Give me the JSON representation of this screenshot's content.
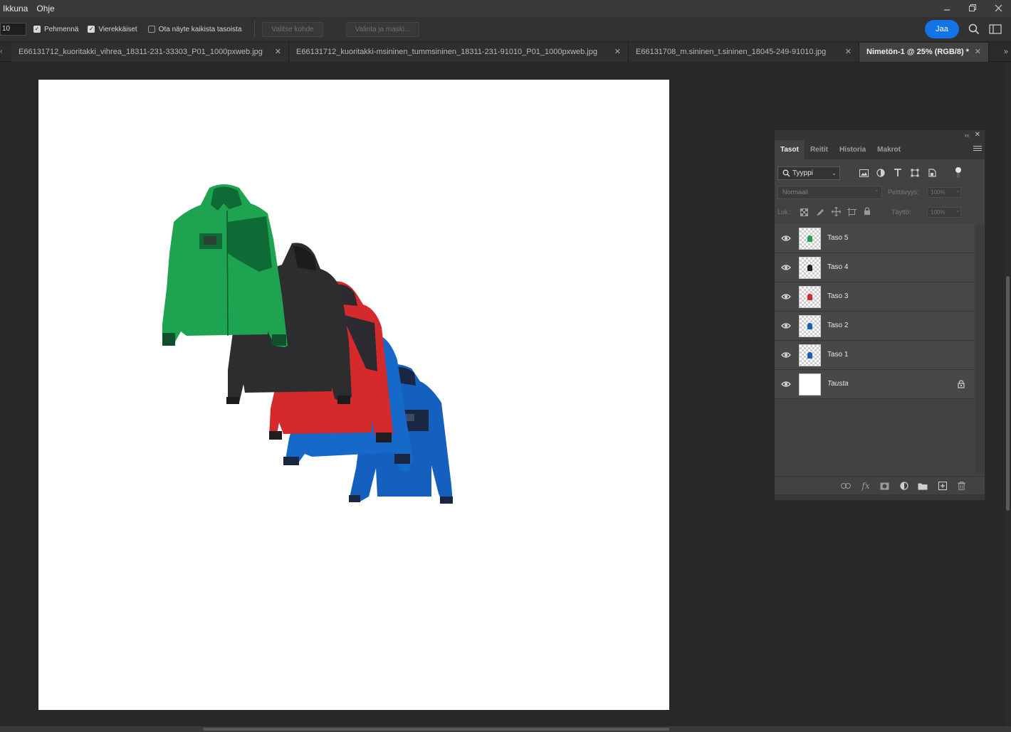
{
  "menubar": {
    "items": [
      "Ikkuna",
      "Ohje"
    ],
    "window_controls": [
      "minimize-icon",
      "restore-icon",
      "close-icon"
    ]
  },
  "options": {
    "size_value": "10",
    "checkboxes": [
      {
        "label": "Pehmennä",
        "checked": true
      },
      {
        "label": "Vierekkäiset",
        "checked": true
      },
      {
        "label": "Ota näyte kaikista tasoista",
        "checked": false
      }
    ],
    "select_subject_label": "Valitse kohde",
    "select_mask_label": "Valinta ja maski...",
    "share_label": "Jaa",
    "icons": [
      "search-icon",
      "workspace-icon"
    ]
  },
  "tabs": [
    {
      "label": "E66131712_kuoritakki_vihrea_18311-231-33303_P01_1000pxweb.jpg",
      "active": false
    },
    {
      "label": "E66131712_kuoritakki-msininen_tummsininen_18311-231-91010_P01_1000pxweb.jpg",
      "active": false
    },
    {
      "label": "E66131708_m.sininen_t.sininen_18045-249-91010.jpg",
      "active": false
    },
    {
      "label": "Nimetön-1 @ 25% (RGB/8) *",
      "active": true
    }
  ],
  "canvas": {
    "jackets": [
      {
        "name": "green-jacket",
        "body": "#1ea351",
        "dark": "#0f6b35"
      },
      {
        "name": "black-jacket",
        "body": "#2d2d2f",
        "dark": "#1c1c1e"
      },
      {
        "name": "red-jacket",
        "body": "#d42a2c",
        "dark": "#2a2a30"
      },
      {
        "name": "royal-blue-jacket",
        "body": "#1669c8",
        "dark": "#1a2742"
      },
      {
        "name": "blue-jacket",
        "body": "#1560bf",
        "dark": "#1a2742"
      }
    ]
  },
  "layers_panel": {
    "tabs": [
      "Tasot",
      "Reitit",
      "Historia",
      "Makrot"
    ],
    "active_tab": "Tasot",
    "filter_label": "Tyyppi",
    "blend_mode": "Normaali",
    "opacity_label": "Peittävyys:",
    "opacity_value": "100%",
    "lock_label": "Luk.:",
    "fill_label": "Täyttö:",
    "fill_value": "100%",
    "layers": [
      {
        "name": "Taso 5",
        "thumb_color": "#1ea351",
        "background": false
      },
      {
        "name": "Taso 4",
        "thumb_color": "#222222",
        "background": false
      },
      {
        "name": "Taso 3",
        "thumb_color": "#d42a2c",
        "background": false
      },
      {
        "name": "Taso 2",
        "thumb_color": "#1560bf",
        "background": false
      },
      {
        "name": "Taso 1",
        "thumb_color": "#1560bf",
        "background": false
      },
      {
        "name": "Tausta",
        "thumb_color": "#ffffff",
        "background": true
      }
    ]
  }
}
